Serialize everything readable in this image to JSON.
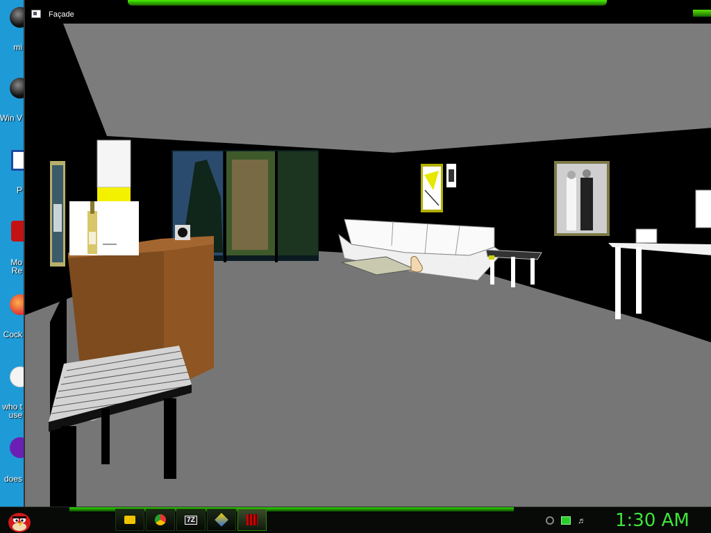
{
  "window": {
    "title": "Façade",
    "title_icon": "window-app-icon"
  },
  "desktop_icons": [
    {
      "label": "mi",
      "icon": "app-shortcut-icon",
      "color": "#222"
    },
    {
      "label": "Win V",
      "icon": "app-shortcut-icon",
      "color": "#222"
    },
    {
      "label": "P",
      "icon": "document-icon",
      "color": "#1c4aa0"
    },
    {
      "label": "Mo Re",
      "icon": "reader-icon",
      "color": "#c41212"
    },
    {
      "label": "Cock",
      "icon": "browser-icon",
      "color": "#e05a1a"
    },
    {
      "label": "who t use",
      "icon": "blank-page-icon",
      "color": "#f0f0f0"
    },
    {
      "label": "does",
      "icon": "yahoo-icon",
      "color": "#6b1fb5"
    }
  ],
  "taskbar": {
    "start_icon": "angry-bird-start-icon",
    "buttons": [
      {
        "name": "file-explorer",
        "icon": "folder-icon",
        "active": false
      },
      {
        "name": "chrome",
        "icon": "chrome-icon",
        "active": false
      },
      {
        "name": "7zip",
        "icon": "7zip-icon",
        "label": "7Z",
        "active": false
      },
      {
        "name": "winamp",
        "icon": "winamp-icon",
        "active": false
      },
      {
        "name": "facade",
        "icon": "facade-app-icon",
        "active": true
      }
    ],
    "tray": [
      "network-speed-icon",
      "display-icon",
      "volume-icon"
    ],
    "clock": "1:30 AM"
  },
  "scene": {
    "description_items": [
      "wine-bottle",
      "kitchen-counter",
      "white-sectional-sofa",
      "wedding-photo",
      "abstract-painting",
      "coffee-table",
      "side-table",
      "desk"
    ],
    "colors": {
      "ceiling": "#7c7c7c",
      "floor": "#767676",
      "walls": "#000000",
      "counter": "#8a5220",
      "accent": "#39d500"
    }
  }
}
